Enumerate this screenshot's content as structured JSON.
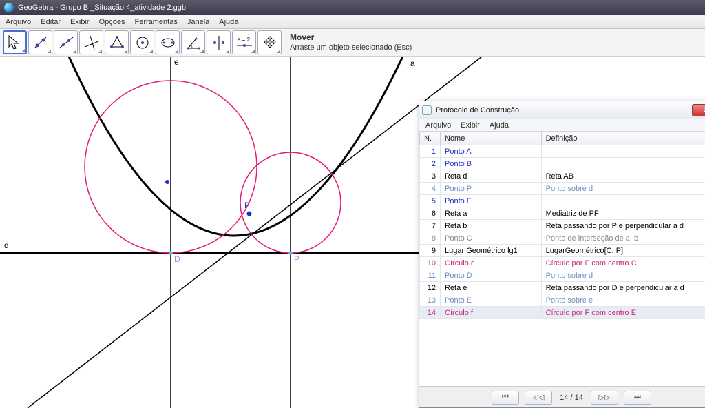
{
  "app": {
    "title": "GeoGebra - Grupo B _Situação 4_atividade 2.ggb"
  },
  "menubar": {
    "items": [
      "Arquivo",
      "Editar",
      "Exibir",
      "Opções",
      "Ferramentas",
      "Janela",
      "Ajuda"
    ]
  },
  "toolbar": {
    "tool_name": "Mover",
    "tool_hint": "Arraste um objeto selecionado (Esc)",
    "tools": [
      {
        "name": "move",
        "label": "Mover"
      },
      {
        "name": "point",
        "label": "Novo Ponto"
      },
      {
        "name": "line",
        "label": "Reta"
      },
      {
        "name": "perpendicular",
        "label": "Reta Perpendicular"
      },
      {
        "name": "polygon",
        "label": "Polígono"
      },
      {
        "name": "circle",
        "label": "Círculo"
      },
      {
        "name": "ellipse",
        "label": "Cônica"
      },
      {
        "name": "angle",
        "label": "Ângulo"
      },
      {
        "name": "reflect",
        "label": "Reflexão"
      },
      {
        "name": "text",
        "label": "Texto a=2"
      },
      {
        "name": "move-graphics",
        "label": "Mover Janela"
      }
    ]
  },
  "graphics_labels": {
    "d": "d",
    "e": "e",
    "a": "a",
    "F": "F",
    "D": "D",
    "P": "P"
  },
  "protocol": {
    "window_title": "Protocolo de Construção",
    "menu": [
      "Arquivo",
      "Exibir",
      "Ajuda"
    ],
    "headers": {
      "n": "N.",
      "nome": "Nome",
      "def": "Definição"
    },
    "rows": [
      {
        "n": 1,
        "nome": "Ponto A",
        "def": "",
        "cls": "row-blue"
      },
      {
        "n": 2,
        "nome": "Ponto B",
        "def": "",
        "cls": "row-blue"
      },
      {
        "n": 3,
        "nome": "Reta d",
        "def": "Reta AB",
        "cls": ""
      },
      {
        "n": 4,
        "nome": "Ponto P",
        "def": "Ponto sobre d",
        "cls": "row-lblue"
      },
      {
        "n": 5,
        "nome": "Ponto F",
        "def": "",
        "cls": "row-blue"
      },
      {
        "n": 6,
        "nome": "Reta a",
        "def": "Mediatriz de PF",
        "cls": ""
      },
      {
        "n": 7,
        "nome": "Reta b",
        "def": "Reta passando por P e perpendicular a d",
        "cls": ""
      },
      {
        "n": 8,
        "nome": "Ponto C",
        "def": "Ponto de interseção de a, b",
        "cls": "row-gray"
      },
      {
        "n": 9,
        "nome": "Lugar Geométrico lg1",
        "def": "LugarGeométrico[C, P]",
        "cls": ""
      },
      {
        "n": 10,
        "nome": "Círculo c",
        "def": "Círculo por F com centro C",
        "cls": "row-pink"
      },
      {
        "n": 11,
        "nome": "Ponto D",
        "def": "Ponto sobre d",
        "cls": "row-lblue"
      },
      {
        "n": 12,
        "nome": "Reta e",
        "def": "Reta passando por D e perpendicular a d",
        "cls": ""
      },
      {
        "n": 13,
        "nome": "Ponto E",
        "def": "Ponto sobre e",
        "cls": "row-lblue"
      },
      {
        "n": 14,
        "nome": "Círculo f",
        "def": "Círculo por F com centro E",
        "cls": "row-pink"
      }
    ],
    "nav_status": "14 / 14"
  }
}
